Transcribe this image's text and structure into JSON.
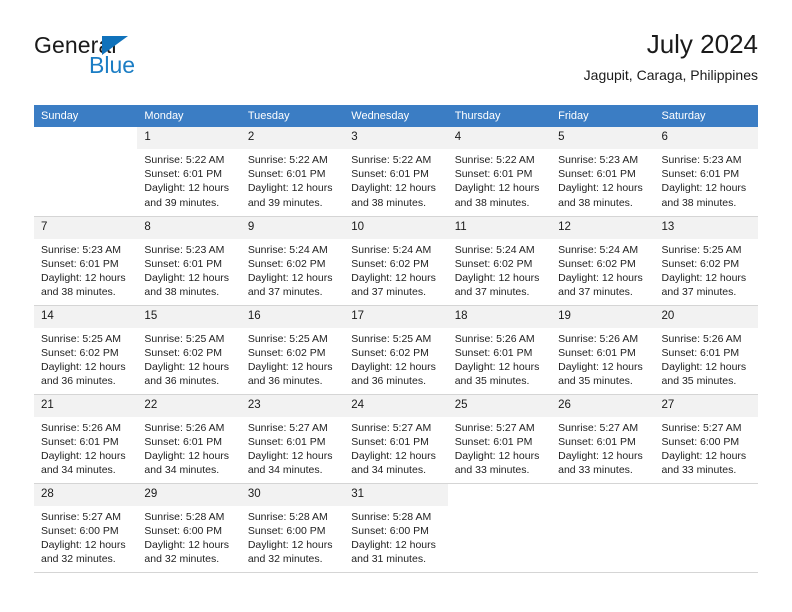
{
  "brand": {
    "name_top": "General",
    "name_bottom": "Blue",
    "accent_color": "#1b7dc4",
    "triangle_color": "#1072bb"
  },
  "header": {
    "title": "July 2024",
    "subtitle": "Jagupit, Caraga, Philippines"
  },
  "calendar": {
    "header_bg": "#3b7dc4",
    "header_text_color": "#ffffff",
    "daynum_bg": "#f2f2f2",
    "weekdays": [
      "Sunday",
      "Monday",
      "Tuesday",
      "Wednesday",
      "Thursday",
      "Friday",
      "Saturday"
    ],
    "labels": {
      "sunrise": "Sunrise:",
      "sunset": "Sunset:",
      "daylight": "Daylight:"
    },
    "weeks": [
      [
        {
          "day": "",
          "sunrise": "",
          "sunset": "",
          "daylight": ""
        },
        {
          "day": "1",
          "sunrise": "Sunrise: 5:22 AM",
          "sunset": "Sunset: 6:01 PM",
          "daylight": "Daylight: 12 hours and 39 minutes."
        },
        {
          "day": "2",
          "sunrise": "Sunrise: 5:22 AM",
          "sunset": "Sunset: 6:01 PM",
          "daylight": "Daylight: 12 hours and 39 minutes."
        },
        {
          "day": "3",
          "sunrise": "Sunrise: 5:22 AM",
          "sunset": "Sunset: 6:01 PM",
          "daylight": "Daylight: 12 hours and 38 minutes."
        },
        {
          "day": "4",
          "sunrise": "Sunrise: 5:22 AM",
          "sunset": "Sunset: 6:01 PM",
          "daylight": "Daylight: 12 hours and 38 minutes."
        },
        {
          "day": "5",
          "sunrise": "Sunrise: 5:23 AM",
          "sunset": "Sunset: 6:01 PM",
          "daylight": "Daylight: 12 hours and 38 minutes."
        },
        {
          "day": "6",
          "sunrise": "Sunrise: 5:23 AM",
          "sunset": "Sunset: 6:01 PM",
          "daylight": "Daylight: 12 hours and 38 minutes."
        }
      ],
      [
        {
          "day": "7",
          "sunrise": "Sunrise: 5:23 AM",
          "sunset": "Sunset: 6:01 PM",
          "daylight": "Daylight: 12 hours and 38 minutes."
        },
        {
          "day": "8",
          "sunrise": "Sunrise: 5:23 AM",
          "sunset": "Sunset: 6:01 PM",
          "daylight": "Daylight: 12 hours and 38 minutes."
        },
        {
          "day": "9",
          "sunrise": "Sunrise: 5:24 AM",
          "sunset": "Sunset: 6:02 PM",
          "daylight": "Daylight: 12 hours and 37 minutes."
        },
        {
          "day": "10",
          "sunrise": "Sunrise: 5:24 AM",
          "sunset": "Sunset: 6:02 PM",
          "daylight": "Daylight: 12 hours and 37 minutes."
        },
        {
          "day": "11",
          "sunrise": "Sunrise: 5:24 AM",
          "sunset": "Sunset: 6:02 PM",
          "daylight": "Daylight: 12 hours and 37 minutes."
        },
        {
          "day": "12",
          "sunrise": "Sunrise: 5:24 AM",
          "sunset": "Sunset: 6:02 PM",
          "daylight": "Daylight: 12 hours and 37 minutes."
        },
        {
          "day": "13",
          "sunrise": "Sunrise: 5:25 AM",
          "sunset": "Sunset: 6:02 PM",
          "daylight": "Daylight: 12 hours and 37 minutes."
        }
      ],
      [
        {
          "day": "14",
          "sunrise": "Sunrise: 5:25 AM",
          "sunset": "Sunset: 6:02 PM",
          "daylight": "Daylight: 12 hours and 36 minutes."
        },
        {
          "day": "15",
          "sunrise": "Sunrise: 5:25 AM",
          "sunset": "Sunset: 6:02 PM",
          "daylight": "Daylight: 12 hours and 36 minutes."
        },
        {
          "day": "16",
          "sunrise": "Sunrise: 5:25 AM",
          "sunset": "Sunset: 6:02 PM",
          "daylight": "Daylight: 12 hours and 36 minutes."
        },
        {
          "day": "17",
          "sunrise": "Sunrise: 5:25 AM",
          "sunset": "Sunset: 6:02 PM",
          "daylight": "Daylight: 12 hours and 36 minutes."
        },
        {
          "day": "18",
          "sunrise": "Sunrise: 5:26 AM",
          "sunset": "Sunset: 6:01 PM",
          "daylight": "Daylight: 12 hours and 35 minutes."
        },
        {
          "day": "19",
          "sunrise": "Sunrise: 5:26 AM",
          "sunset": "Sunset: 6:01 PM",
          "daylight": "Daylight: 12 hours and 35 minutes."
        },
        {
          "day": "20",
          "sunrise": "Sunrise: 5:26 AM",
          "sunset": "Sunset: 6:01 PM",
          "daylight": "Daylight: 12 hours and 35 minutes."
        }
      ],
      [
        {
          "day": "21",
          "sunrise": "Sunrise: 5:26 AM",
          "sunset": "Sunset: 6:01 PM",
          "daylight": "Daylight: 12 hours and 34 minutes."
        },
        {
          "day": "22",
          "sunrise": "Sunrise: 5:26 AM",
          "sunset": "Sunset: 6:01 PM",
          "daylight": "Daylight: 12 hours and 34 minutes."
        },
        {
          "day": "23",
          "sunrise": "Sunrise: 5:27 AM",
          "sunset": "Sunset: 6:01 PM",
          "daylight": "Daylight: 12 hours and 34 minutes."
        },
        {
          "day": "24",
          "sunrise": "Sunrise: 5:27 AM",
          "sunset": "Sunset: 6:01 PM",
          "daylight": "Daylight: 12 hours and 34 minutes."
        },
        {
          "day": "25",
          "sunrise": "Sunrise: 5:27 AM",
          "sunset": "Sunset: 6:01 PM",
          "daylight": "Daylight: 12 hours and 33 minutes."
        },
        {
          "day": "26",
          "sunrise": "Sunrise: 5:27 AM",
          "sunset": "Sunset: 6:01 PM",
          "daylight": "Daylight: 12 hours and 33 minutes."
        },
        {
          "day": "27",
          "sunrise": "Sunrise: 5:27 AM",
          "sunset": "Sunset: 6:00 PM",
          "daylight": "Daylight: 12 hours and 33 minutes."
        }
      ],
      [
        {
          "day": "28",
          "sunrise": "Sunrise: 5:27 AM",
          "sunset": "Sunset: 6:00 PM",
          "daylight": "Daylight: 12 hours and 32 minutes."
        },
        {
          "day": "29",
          "sunrise": "Sunrise: 5:28 AM",
          "sunset": "Sunset: 6:00 PM",
          "daylight": "Daylight: 12 hours and 32 minutes."
        },
        {
          "day": "30",
          "sunrise": "Sunrise: 5:28 AM",
          "sunset": "Sunset: 6:00 PM",
          "daylight": "Daylight: 12 hours and 32 minutes."
        },
        {
          "day": "31",
          "sunrise": "Sunrise: 5:28 AM",
          "sunset": "Sunset: 6:00 PM",
          "daylight": "Daylight: 12 hours and 31 minutes."
        },
        {
          "day": "",
          "sunrise": "",
          "sunset": "",
          "daylight": ""
        },
        {
          "day": "",
          "sunrise": "",
          "sunset": "",
          "daylight": ""
        },
        {
          "day": "",
          "sunrise": "",
          "sunset": "",
          "daylight": ""
        }
      ]
    ]
  }
}
